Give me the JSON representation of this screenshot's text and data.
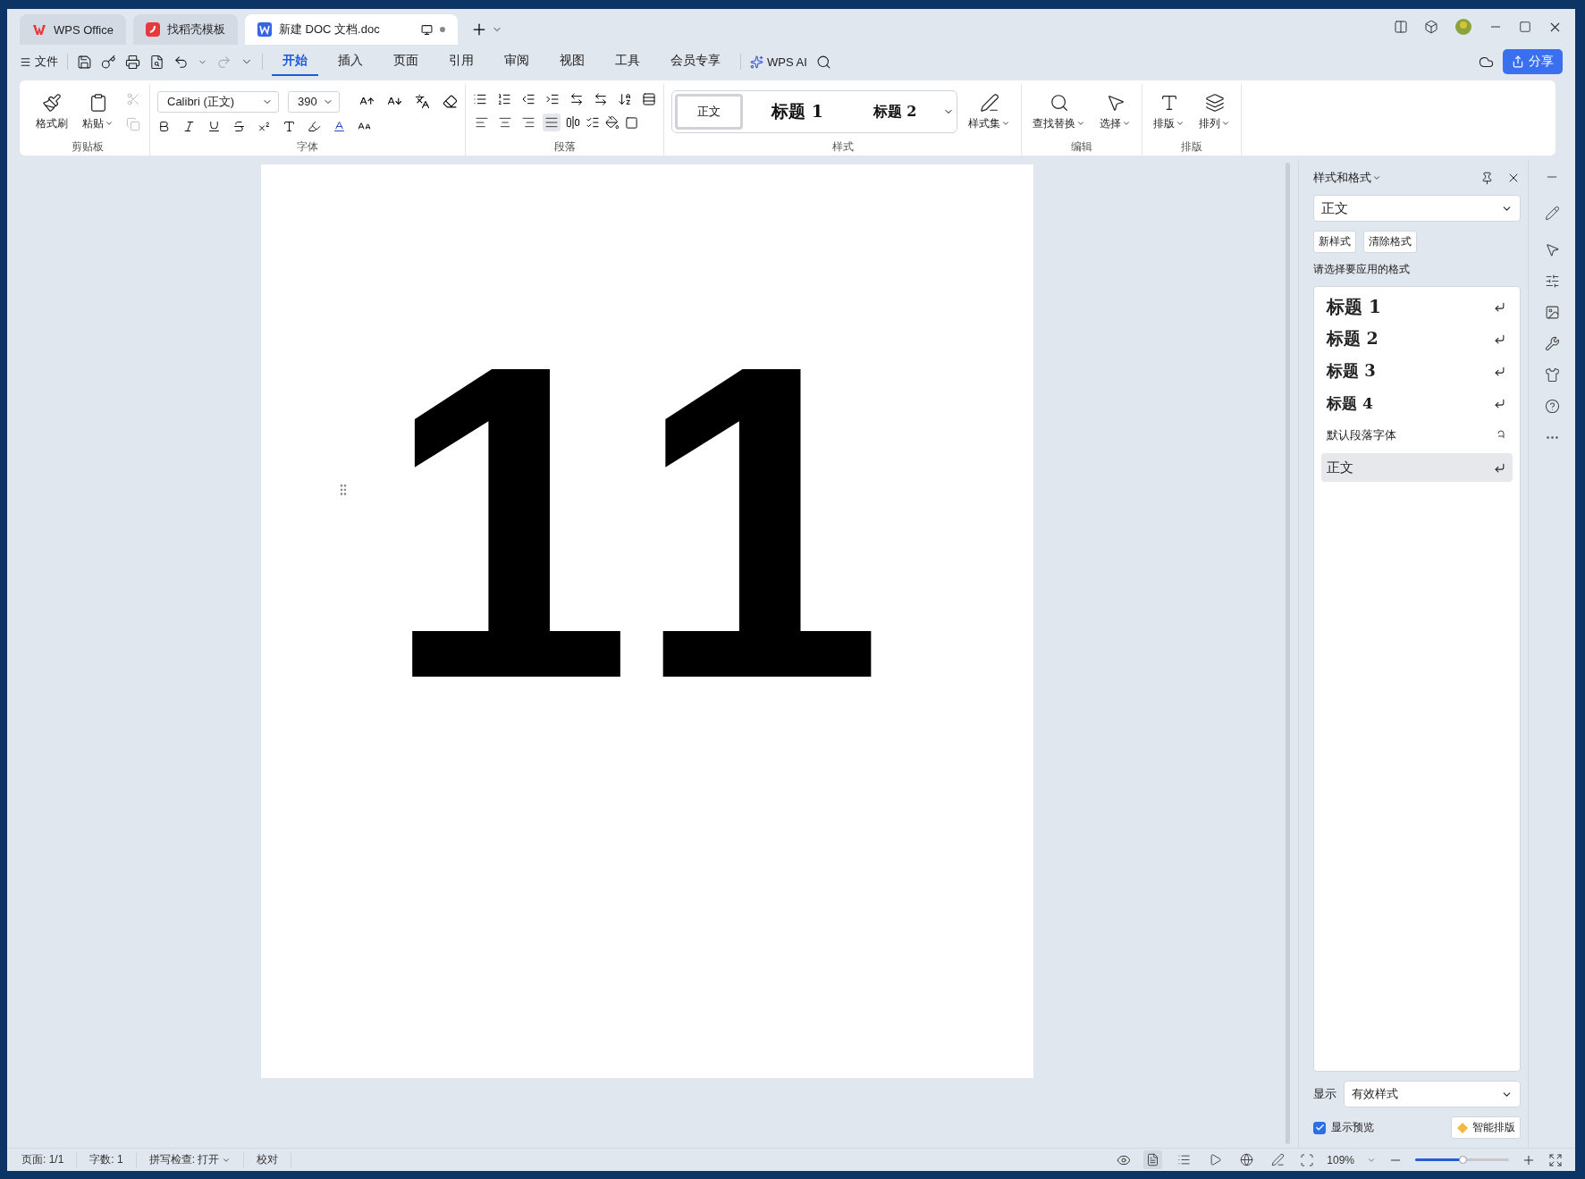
{
  "tabs": [
    {
      "label": "WPS Office",
      "kind": "home",
      "selected": false
    },
    {
      "label": "找稻壳模板",
      "kind": "template",
      "selected": false
    },
    {
      "label": "新建 DOC 文档.doc",
      "kind": "doc",
      "selected": true
    }
  ],
  "menu": {
    "file": "文件",
    "tabs": [
      {
        "label": "开始",
        "selected": true
      },
      {
        "label": "插入",
        "selected": false
      },
      {
        "label": "页面",
        "selected": false
      },
      {
        "label": "引用",
        "selected": false
      },
      {
        "label": "审阅",
        "selected": false
      },
      {
        "label": "视图",
        "selected": false
      },
      {
        "label": "工具",
        "selected": false
      },
      {
        "label": "会员专享",
        "selected": false
      }
    ],
    "ai": "WPS AI",
    "share": "分享"
  },
  "ribbon": {
    "clipboard": {
      "title": "剪贴板",
      "buttons": [
        {
          "label": "格式刷",
          "dropdown": false
        },
        {
          "label": "粘贴",
          "dropdown": true
        }
      ],
      "cut": {
        "disabled": true
      },
      "copy": {
        "disabled": true
      }
    },
    "font": {
      "title": "字体",
      "font": "Calibri (正文)",
      "size": "390"
    },
    "paragraph": {
      "title": "段落",
      "alignment": [
        {
          "selected": false
        },
        {
          "selected": false
        },
        {
          "selected": false
        },
        {
          "selected": true
        }
      ]
    },
    "styles": {
      "title": "样式",
      "gallery": [
        {
          "label": "正文",
          "kind": "body",
          "selected": true
        },
        {
          "label": "标题 1",
          "kind": "heading1",
          "selected": false
        },
        {
          "label": "标题 2",
          "kind": "heading2",
          "selected": false
        }
      ],
      "set": "样式集"
    },
    "editing": {
      "title": "编辑",
      "buttons": [
        {
          "label": "查找替换",
          "kind": "find"
        },
        {
          "label": "选择",
          "kind": "select"
        }
      ]
    },
    "layout": {
      "title": "排版",
      "buttons": [
        {
          "label": "排版",
          "kind": "typeset"
        },
        {
          "label": "排列",
          "kind": "arrange"
        }
      ]
    }
  },
  "document": {
    "text": "11"
  },
  "styles_panel": {
    "title": "样式和格式",
    "current": "正文",
    "buttons": [
      "新样式",
      "清除格式"
    ],
    "prompt": "请选择要应用的格式",
    "items": [
      {
        "label": "标题 1",
        "kind": "heading1",
        "selected": false
      },
      {
        "label": "标题 2",
        "kind": "heading2",
        "selected": false
      },
      {
        "label": "标题 3",
        "kind": "heading3",
        "selected": false
      },
      {
        "label": "标题 4",
        "kind": "heading4",
        "selected": false
      },
      {
        "label": "默认段落字体",
        "kind": "character",
        "selected": false
      },
      {
        "label": "正文",
        "kind": "body",
        "selected": true
      }
    ],
    "show_label": "显示",
    "show_value": "有效样式",
    "preview": {
      "label": "显示预览",
      "checked": true
    },
    "smart": "智能排版"
  },
  "status_bar": {
    "items": [
      {
        "label": "页面: 1/1",
        "dropdown": false
      },
      {
        "label": "字数: 1",
        "dropdown": false
      },
      {
        "label": "拼写检查: 打开",
        "dropdown": true
      },
      {
        "label": "校对",
        "dropdown": false
      }
    ],
    "views": [
      {
        "kind": "print",
        "selected": true
      },
      {
        "kind": "outline",
        "selected": false
      },
      {
        "kind": "read",
        "selected": false
      },
      {
        "kind": "web",
        "selected": false
      },
      {
        "kind": "write",
        "selected": false
      }
    ],
    "zoom": "109%",
    "zoom_slider": {
      "level": 0.5
    }
  }
}
